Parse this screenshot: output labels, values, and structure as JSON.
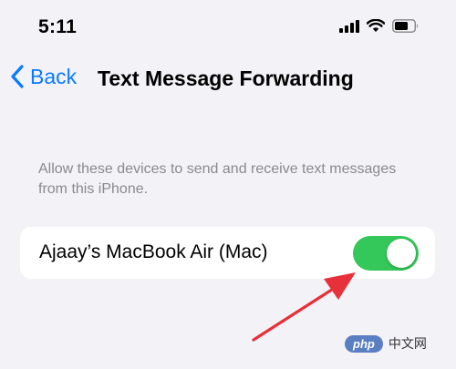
{
  "status_bar": {
    "time": "5:11",
    "icons": [
      "cellular-signal-icon",
      "wifi-icon",
      "battery-icon"
    ]
  },
  "nav": {
    "back_label": "Back",
    "title": "Text Message Forwarding"
  },
  "section": {
    "footer_text": "Allow these devices to send and receive text messages from this iPhone."
  },
  "devices": [
    {
      "label": "Ajaay’s MacBook Air (Mac)",
      "enabled": true
    }
  ],
  "colors": {
    "background": "#f2f2f7",
    "accent": "#0a7aff",
    "toggle_on": "#34c759",
    "annotation_arrow": "#e8303a"
  },
  "watermark": {
    "logo": "php",
    "text": "中文网"
  }
}
